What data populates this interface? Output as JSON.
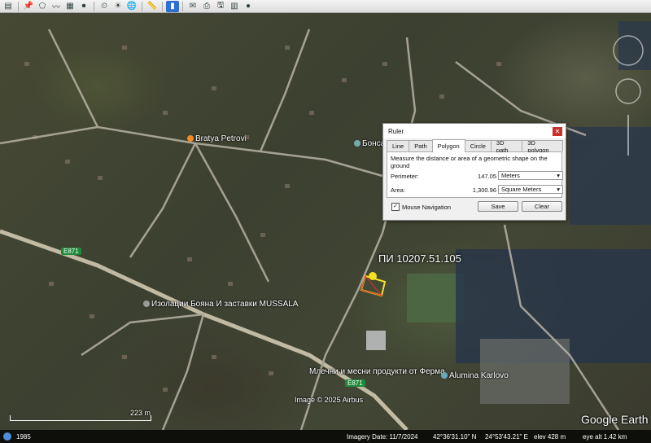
{
  "toolbar": {
    "icons": [
      "sidebar-icon",
      "placemark-icon",
      "polygon-icon",
      "path-icon",
      "overlay-icon",
      "record-tour-icon",
      "historical-imagery-icon",
      "sun-icon",
      "planets-icon",
      "ruler-icon",
      "email-icon",
      "print-icon",
      "save-image-icon",
      "maps-icon",
      "earth-icon"
    ]
  },
  "map": {
    "places": {
      "bratya_petrovi": "Bratya Petrovi",
      "bonsai": "Бонсай",
      "mussala": "Изолации Бояна И заставки MUSSALA",
      "ferma": "Млечни и месни продукти от Ферма",
      "alumina": "Alumina Karlovo"
    },
    "road_e871_a": "E871",
    "road_e871_b": "E871",
    "parcel": "ПИ 10207.51.105",
    "copyright": "Image © 2025 Airbus",
    "logo": "Google Earth",
    "scale_label": "223 m"
  },
  "ruler": {
    "title": "Ruler",
    "tabs": [
      "Line",
      "Path",
      "Polygon",
      "Circle",
      "3D path",
      "3D polygon"
    ],
    "selected_tab": "Polygon",
    "description": "Measure the distance or area of a geometric shape on the ground",
    "perimeter": {
      "label": "Perimeter:",
      "value": "147.05",
      "unit": "Meters"
    },
    "area": {
      "label": "Area:",
      "value": "1,300.96",
      "unit": "Square Meters"
    },
    "mouse_navigation": "Mouse Navigation",
    "save": "Save",
    "clear": "Clear"
  },
  "status": {
    "year": "1985",
    "imagery_date": "Imagery Date: 11/7/2024",
    "lat": "42°36'31.10\" N",
    "lon": "24°53'43.21\" E",
    "elev": "elev   428 m",
    "eye_alt": "eye alt   1.42 km"
  }
}
